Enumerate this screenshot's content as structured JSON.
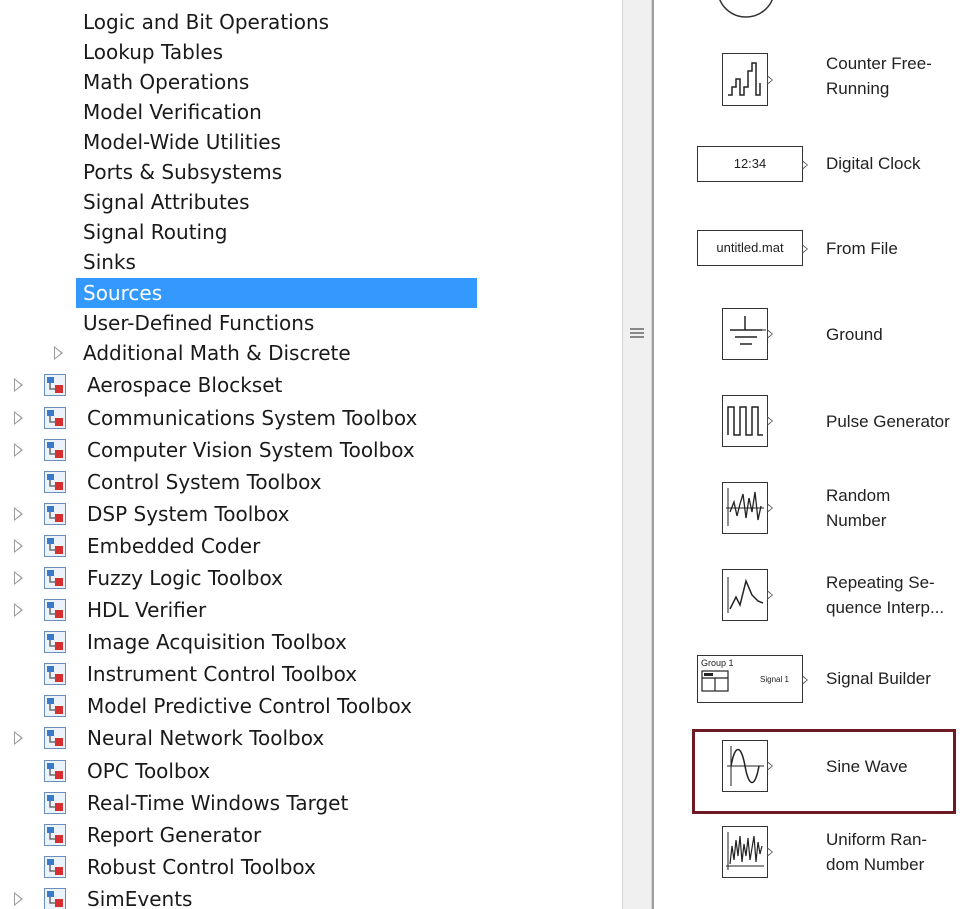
{
  "tree": {
    "sub_items": [
      {
        "label": "Logic and Bit Operations"
      },
      {
        "label": "Lookup Tables"
      },
      {
        "label": "Math Operations"
      },
      {
        "label": "Model Verification"
      },
      {
        "label": "Model-Wide Utilities"
      },
      {
        "label": "Ports & Subsystems"
      },
      {
        "label": "Signal Attributes"
      },
      {
        "label": "Signal Routing"
      },
      {
        "label": "Sinks"
      },
      {
        "label": "Sources",
        "selected": true
      },
      {
        "label": "User-Defined Functions"
      },
      {
        "label": "Additional Math & Discrete",
        "expandable": true
      }
    ],
    "toolboxes": [
      {
        "label": "Aerospace Blockset",
        "expandable": true
      },
      {
        "label": "Communications System Toolbox",
        "expandable": true
      },
      {
        "label": "Computer Vision System Toolbox",
        "expandable": true
      },
      {
        "label": "Control System Toolbox",
        "expandable": false
      },
      {
        "label": "DSP System Toolbox",
        "expandable": true
      },
      {
        "label": "Embedded Coder",
        "expandable": true
      },
      {
        "label": "Fuzzy Logic Toolbox",
        "expandable": true
      },
      {
        "label": "HDL Verifier",
        "expandable": true
      },
      {
        "label": "Image Acquisition Toolbox",
        "expandable": false
      },
      {
        "label": "Instrument Control Toolbox",
        "expandable": false
      },
      {
        "label": "Model Predictive Control Toolbox",
        "expandable": false
      },
      {
        "label": "Neural Network Toolbox",
        "expandable": true
      },
      {
        "label": "OPC Toolbox",
        "expandable": false
      },
      {
        "label": "Real-Time Windows Target",
        "expandable": false
      },
      {
        "label": "Report Generator",
        "expandable": false
      },
      {
        "label": "Robust Control Toolbox",
        "expandable": false
      },
      {
        "label": "SimEvents",
        "expandable": true
      }
    ],
    "selection_color": "#3399ff",
    "library_icon": "simulink-library-icon"
  },
  "blocks": [
    {
      "id": "counter-free-running",
      "label_lines": [
        "Counter Free-",
        "Running"
      ],
      "icon": "counter-staircase-icon"
    },
    {
      "id": "digital-clock",
      "label_lines": [
        "Digital Clock"
      ],
      "icon": "digital-clock-icon",
      "box_text": "12:34"
    },
    {
      "id": "from-file",
      "label_lines": [
        "From File"
      ],
      "icon": "from-file-icon",
      "box_text": "untitled.mat"
    },
    {
      "id": "ground",
      "label_lines": [
        "Ground"
      ],
      "icon": "ground-icon"
    },
    {
      "id": "pulse-generator",
      "label_lines": [
        "Pulse Generator"
      ],
      "icon": "pulse-train-icon"
    },
    {
      "id": "random-number",
      "label_lines": [
        "Random",
        "Number"
      ],
      "icon": "random-signal-icon"
    },
    {
      "id": "repeating-sequence-interp",
      "label_lines": [
        "Repeating Se-",
        "quence Interp..."
      ],
      "icon": "repeating-sequence-icon"
    },
    {
      "id": "signal-builder",
      "label_lines": [
        "Signal Builder"
      ],
      "icon": "signal-builder-icon",
      "box_text_group": "Group 1",
      "box_text_signal": "Signal 1"
    },
    {
      "id": "sine-wave",
      "label_lines": [
        "Sine Wave"
      ],
      "icon": "sine-wave-icon",
      "highlighted": true
    },
    {
      "id": "uniform-random-number",
      "label_lines": [
        "Uniform Ran-",
        "dom Number"
      ],
      "icon": "uniform-random-icon"
    }
  ],
  "highlight_color": "#6e1a23"
}
